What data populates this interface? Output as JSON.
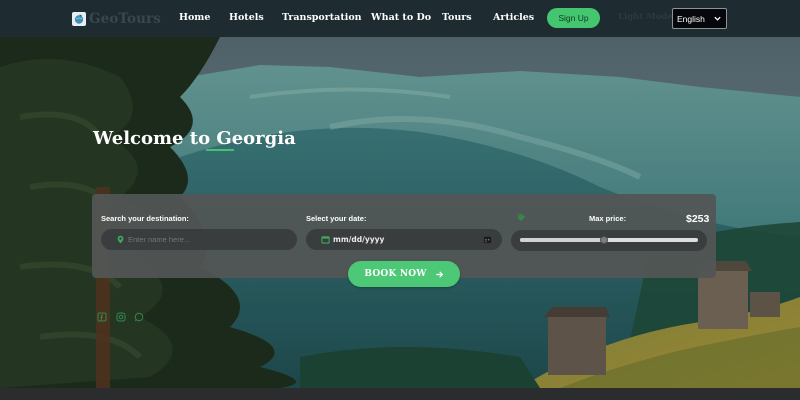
{
  "brand": {
    "name": "GeoTours",
    "logo_icon": "globe-plane-icon"
  },
  "nav": {
    "items": [
      {
        "label": "Home"
      },
      {
        "label": "Hotels"
      },
      {
        "label": "Transportation"
      },
      {
        "label": "What to Do"
      },
      {
        "label": "Tours"
      },
      {
        "label": "Articles"
      }
    ],
    "signup_label": "Sign Up",
    "mode_label": "Light Mode",
    "language": {
      "selected": "English"
    }
  },
  "hero": {
    "title": "Welcome to Georgia",
    "search": {
      "destination_label": "Search your destination:",
      "destination_placeholder": "Enter name here...",
      "date_label": "Select your date:",
      "date_value": "mm/dd/yyyy",
      "price_label": "Max price:",
      "price_value": "$253",
      "price_slider_fraction": 0.47
    },
    "book_label": "BOOK NOW",
    "social_icons": [
      "facebook-icon",
      "instagram-icon",
      "whatsapp-icon"
    ]
  },
  "colors": {
    "navbar": "#1e2b31",
    "accent_green": "#45c170",
    "panel": "#525655",
    "field": "#3a3d3d"
  }
}
